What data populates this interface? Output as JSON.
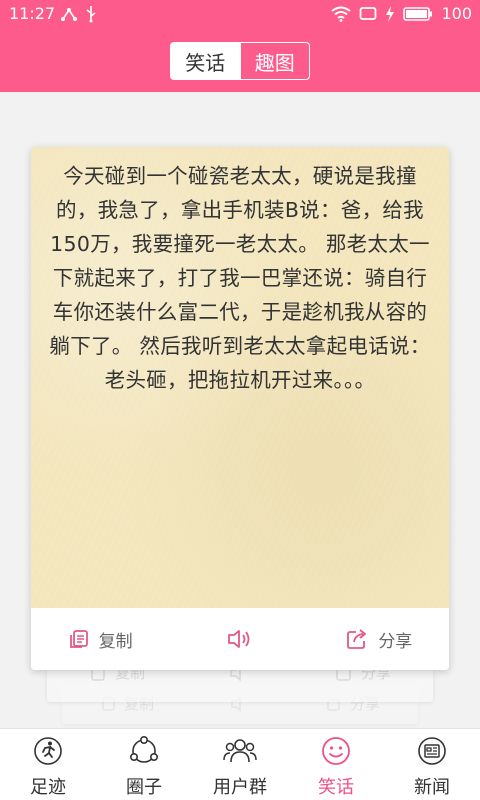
{
  "status_bar": {
    "time": "11:27",
    "battery": "100"
  },
  "header": {
    "tabs": [
      {
        "label": "笑话",
        "active": true
      },
      {
        "label": "趣图",
        "active": false
      }
    ]
  },
  "card": {
    "text": "今天碰到一个碰瓷老太太，硬说是我撞的，我急了，拿出手机装B说：爸，给我150万，我要撞死一老太太。 那老太太一下就起来了，打了我一巴掌还说：骑自行车你还装什么富二代，于是趁机我从容的躺下了。 然后我听到老太太拿起电话说：老头砸，把拖拉机开过来。。。",
    "actions": {
      "copy": "复制",
      "share": "分享"
    }
  },
  "tabbar": {
    "items": [
      {
        "label": "足迹",
        "icon": "footprint-icon"
      },
      {
        "label": "圈子",
        "icon": "circle-icon"
      },
      {
        "label": "用户群",
        "icon": "user-group-icon"
      },
      {
        "label": "笑话",
        "icon": "smile-icon"
      },
      {
        "label": "新闻",
        "icon": "news-icon"
      }
    ]
  },
  "colors": {
    "brand": "#fd5b8c",
    "active_tab": "#f0508a",
    "paper": "#f3e6bd"
  }
}
